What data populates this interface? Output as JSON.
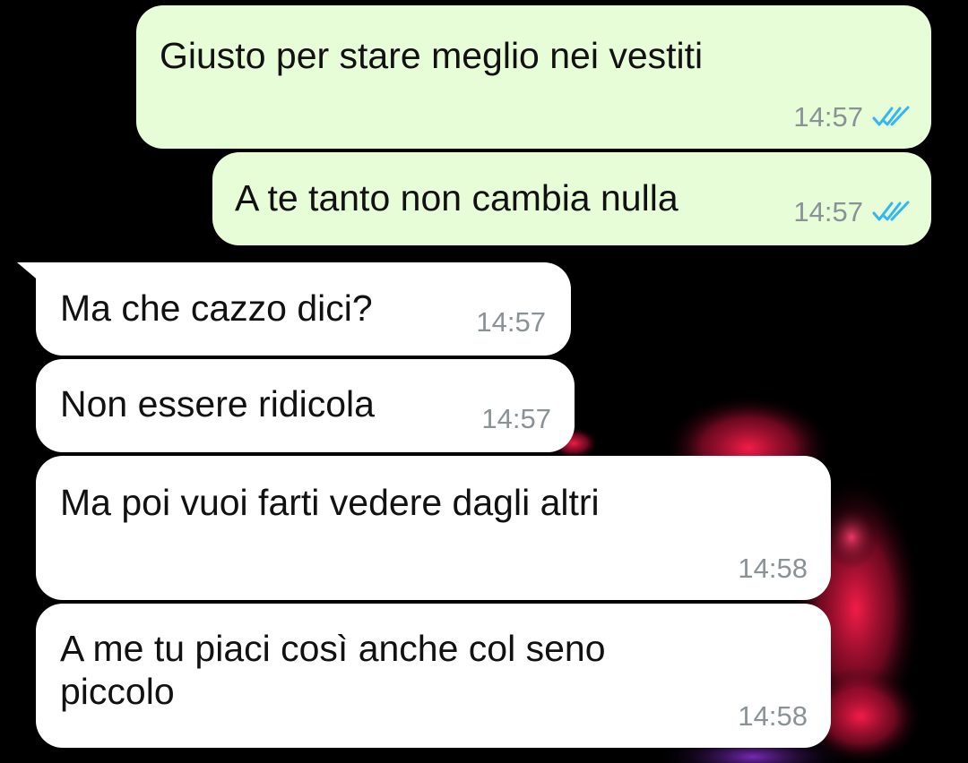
{
  "messages": [
    {
      "direction": "outgoing",
      "text": "Giusto per stare meglio nei vestiti",
      "time": "14:57",
      "status_icon": "double-check-read-icon"
    },
    {
      "direction": "outgoing",
      "text": "A te tanto non cambia nulla",
      "time": "14:57",
      "status_icon": "double-check-read-icon"
    },
    {
      "direction": "incoming",
      "text": "Ma che cazzo dici?",
      "time": "14:57"
    },
    {
      "direction": "incoming",
      "text": "Non essere ridicola",
      "time": "14:57"
    },
    {
      "direction": "incoming",
      "text": "Ma poi vuoi farti vedere dagli altri",
      "time": "14:58"
    },
    {
      "direction": "incoming",
      "text": "A me tu piaci così anche col seno\npiccolo",
      "time": "14:58"
    }
  ],
  "colors": {
    "outgoing_bubble": "#e7fdd8",
    "incoming_bubble": "#ffffff",
    "read_ticks": "#34b7f1",
    "timestamp": "#8a9296",
    "background": "#000000"
  }
}
